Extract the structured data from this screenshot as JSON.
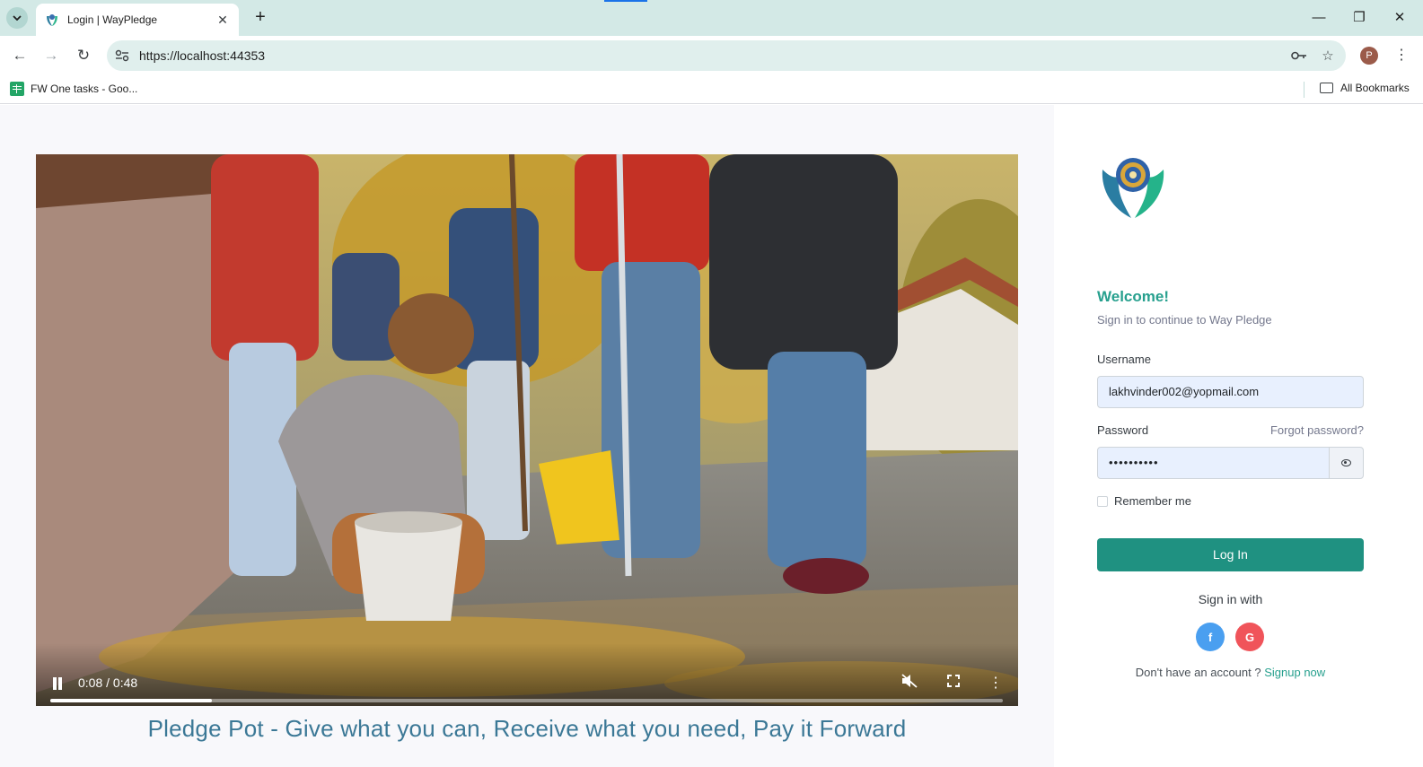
{
  "browser": {
    "tab_title": "Login | WayPledge",
    "url": "https://localhost:44353",
    "bookmark_label": "FW One tasks - Goo...",
    "all_bookmarks_label": "All Bookmarks",
    "profile_initial": "P"
  },
  "video": {
    "time_display": "0:08 / 0:48",
    "progress_fraction": 0.17,
    "muted": true
  },
  "tagline": "Pledge Pot - Give what you can, Receive what you need, Pay it Forward",
  "login": {
    "welcome": "Welcome!",
    "subtitle": "Sign in to continue to Way Pledge",
    "username_label": "Username",
    "username_value": "lakhvinder002@yopmail.com",
    "password_label": "Password",
    "password_value": "••••••••••",
    "forgot_label": "Forgot password?",
    "remember_label": "Remember me",
    "login_button": "Log In",
    "sign_in_with": "Sign in with",
    "facebook_glyph": "f",
    "google_glyph": "G",
    "no_account_text": "Don't have an account ?",
    "signup_link": "Signup now"
  },
  "colors": {
    "accent": "#1f9181",
    "welcome": "#27a08e",
    "tagline": "#3b7896",
    "facebook": "#4a9ff0",
    "google": "#f0545a"
  },
  "icons": {
    "facebook": "facebook-icon",
    "google": "google-icon",
    "eye": "eye-icon",
    "pause": "pause-icon",
    "muted": "volume-muted-icon",
    "fullscreen": "fullscreen-icon",
    "more": "more-vert-icon"
  }
}
